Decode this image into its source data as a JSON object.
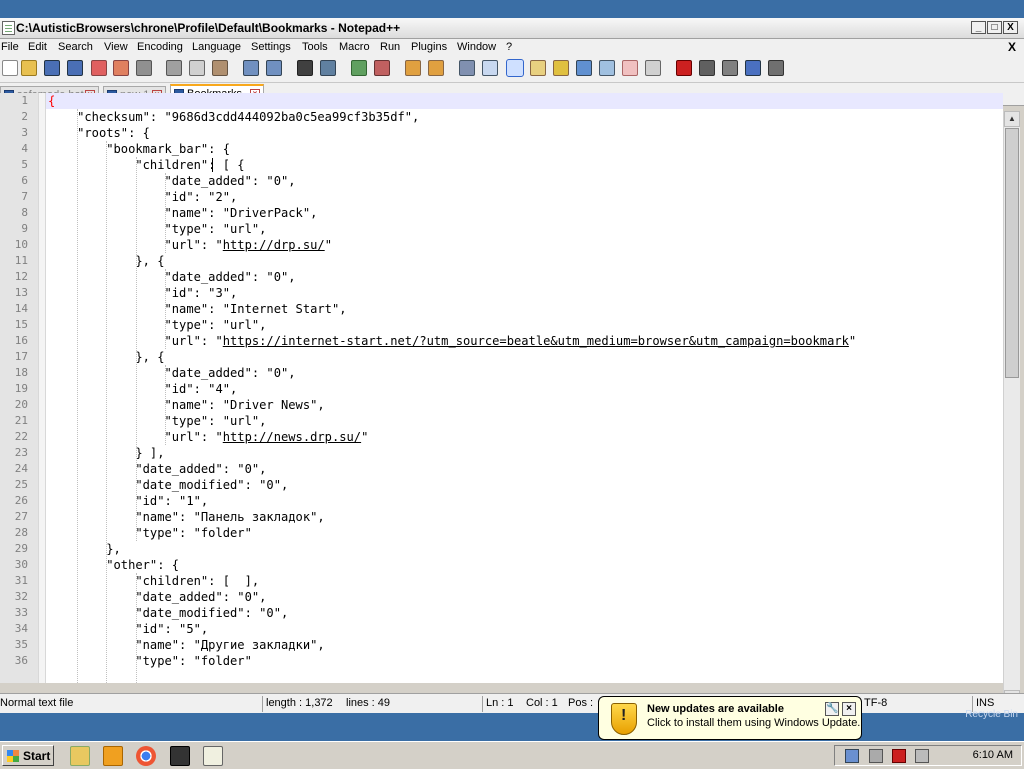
{
  "window": {
    "title": "C:\\AutisticBrowsers\\chrone\\Profile\\Default\\Bookmarks - Notepad++",
    "minimize": "_",
    "maximize": "□",
    "close": "X"
  },
  "menu": {
    "items": [
      "File",
      "Edit",
      "Search",
      "View",
      "Encoding",
      "Language",
      "Settings",
      "Tools",
      "Macro",
      "Run",
      "Plugins",
      "Window",
      "?"
    ],
    "close_doc": "X"
  },
  "tabs": [
    {
      "label": "safemode.bat",
      "active": false
    },
    {
      "label": "new 1",
      "active": false
    },
    {
      "label": "Bookmarks",
      "active": true
    }
  ],
  "editor": {
    "lines": [
      "{",
      "    \"checksum\": \"9686d3cdd444092ba0c5ea99cf3b35df\",",
      "    \"roots\": {",
      "        \"bookmark_bar\": {",
      "            \"children\": [ {",
      "                \"date_added\": \"0\",",
      "                \"id\": \"2\",",
      "                \"name\": \"DriverPack\",",
      "                \"type\": \"url\",",
      "                \"url\": \"http://drp.su/\"",
      "            }, {",
      "                \"date_added\": \"0\",",
      "                \"id\": \"3\",",
      "                \"name\": \"Internet Start\",",
      "                \"type\": \"url\",",
      "                \"url\": \"https://internet-start.net/?utm_source=beatle&utm_medium=browser&utm_campaign=bookmark\"",
      "            }, {",
      "                \"date_added\": \"0\",",
      "                \"id\": \"4\",",
      "                \"name\": \"Driver News\",",
      "                \"type\": \"url\",",
      "                \"url\": \"http://news.drp.su/\"",
      "            } ],",
      "            \"date_added\": \"0\",",
      "            \"date_modified\": \"0\",",
      "            \"id\": \"1\",",
      "            \"name\": \"Панель закладок\",",
      "            \"type\": \"folder\"",
      "        },",
      "        \"other\": {",
      "            \"children\": [  ],",
      "            \"date_added\": \"0\",",
      "            \"date_modified\": \"0\",",
      "            \"id\": \"5\",",
      "            \"name\": \"Другие закладки\",",
      "            \"type\": \"folder\""
    ],
    "links": [
      "http://drp.su/",
      "https://internet-start.net/?utm_source=beatle&utm_medium=browser&utm_campaign=bookmark",
      "http://news.drp.su/"
    ]
  },
  "status": {
    "file_type": "Normal text file",
    "length": "length : 1,372",
    "lines": "lines : 49",
    "ln": "Ln : 1",
    "col": "Col : 1",
    "pos": "Pos :",
    "encoding": "TF-8",
    "mode": "INS"
  },
  "desktop": {
    "recycle_bin_label": "Recycle Bin"
  },
  "balloon": {
    "title": "New updates are available",
    "text": "Click to install them using Windows Update."
  },
  "taskbar": {
    "start_label": "Start",
    "clock": "6:10 AM"
  },
  "colors": {
    "desktop": "#3a6ea5",
    "active_tab_accent": "#f8a81c",
    "brace": "#ff0000",
    "balloon_bg": "#ffffe1"
  }
}
